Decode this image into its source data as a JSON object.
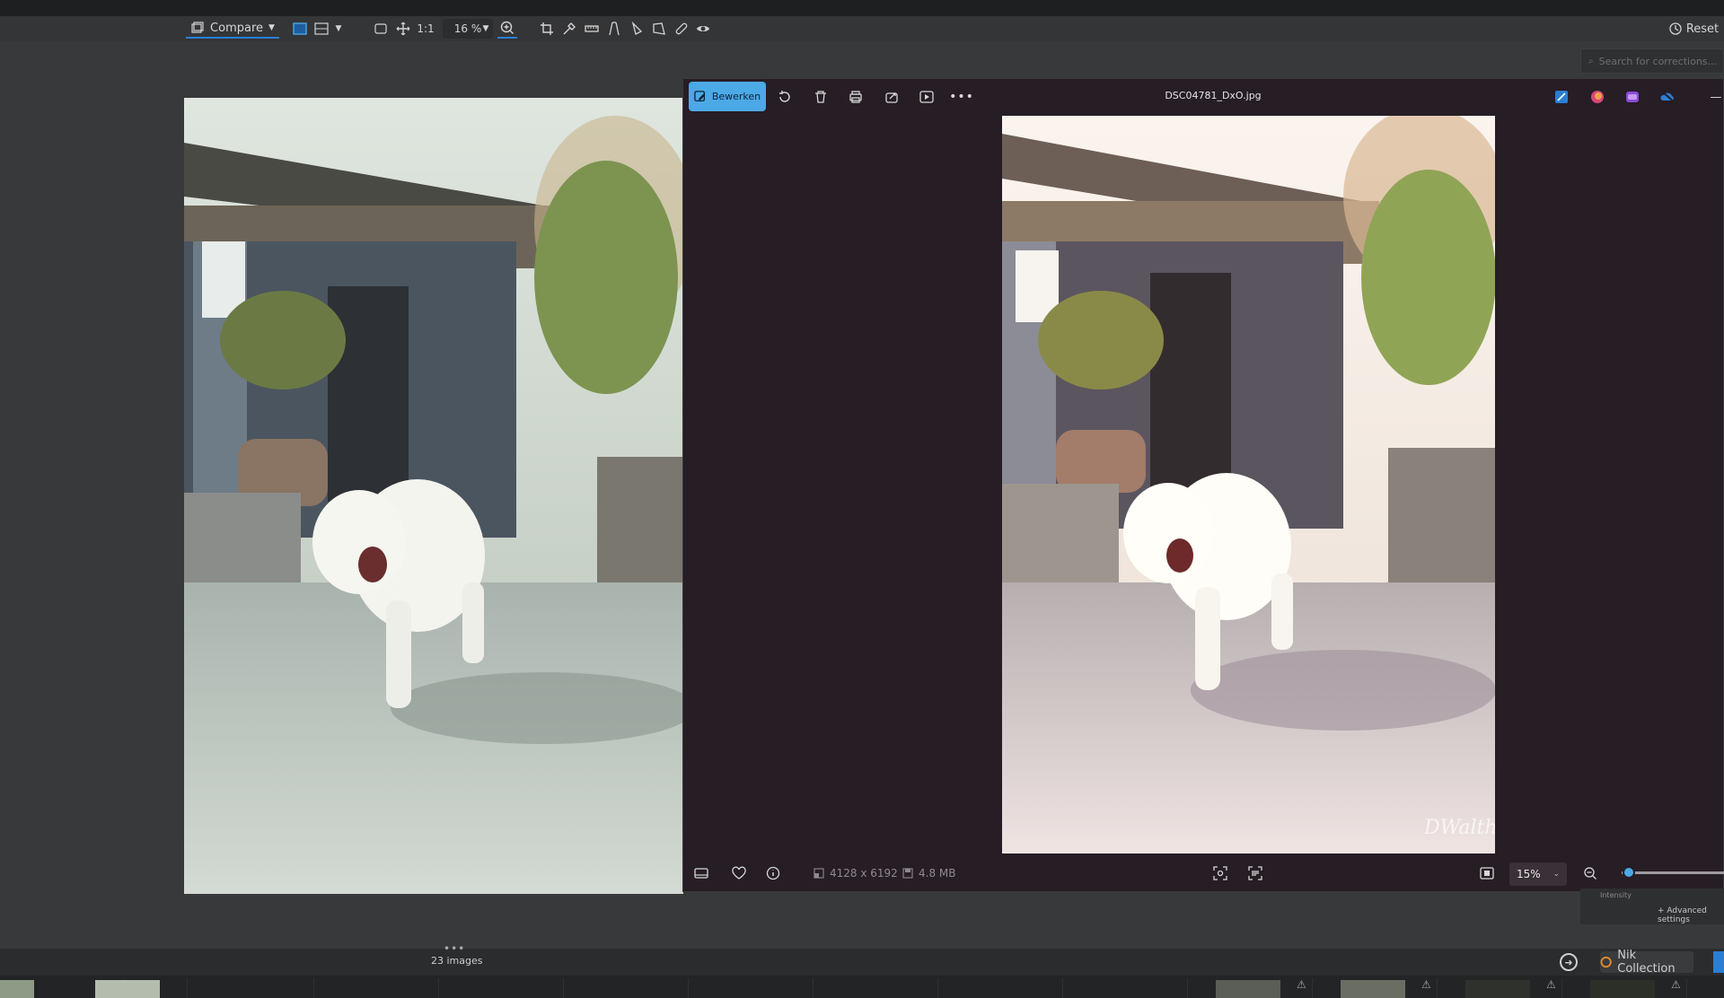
{
  "toolbar": {
    "compare_label": "Compare",
    "zoom_value": "16 %",
    "one_to_one": "1:1",
    "reset_label": "Reset"
  },
  "search": {
    "placeholder": "Search for corrections..."
  },
  "viewer": {
    "edit_label": "Bewerken",
    "filename": "DSC04781_DxO.jpg",
    "dimensions": "4128 x 6192",
    "filesize": "4.8 MB",
    "zoom": "15%",
    "zoom_level": 0.05,
    "signature": "DWalther"
  },
  "panel": {
    "intensity_label": "Intensity",
    "advanced_label": "+ Advanced settings"
  },
  "browser": {
    "images_count": "23 images",
    "nik_label": "Nik Collection"
  },
  "colors": {
    "accent": "#4ba9e6",
    "toolbar_accent": "#2a7fd4",
    "viewer_bg": "#261d25",
    "app_bg": "#38393b"
  }
}
